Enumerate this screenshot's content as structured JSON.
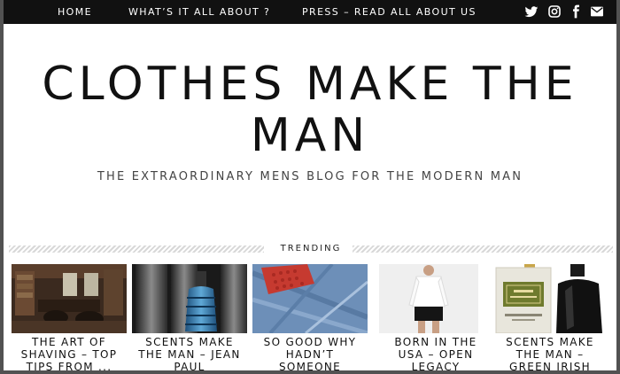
{
  "nav": {
    "items": [
      "HOME",
      "WHAT’S IT ALL ABOUT ?",
      "PRESS – READ ALL ABOUT US"
    ],
    "social_icons": [
      "twitter-icon",
      "instagram-icon",
      "facebook-icon",
      "email-icon"
    ]
  },
  "header": {
    "title_line1": "CLOTHES MAKE THE",
    "title_line2": "MAN",
    "tagline": "THE EXTRAORDINARY MENS BLOG FOR THE MODERN MAN"
  },
  "trending": {
    "label": "TRENDING",
    "cards": [
      {
        "title": "THE ART OF SHAVING – TOP TIPS FROM ..."
      },
      {
        "title": "SCENTS MAKE THE MAN – JEAN PAUL"
      },
      {
        "title": "SO GOOD WHY HADN’T SOMEONE"
      },
      {
        "title": "BORN IN THE USA – OPEN LEGACY"
      },
      {
        "title": "SCENTS MAKE THE MAN – GREEN IRISH"
      }
    ]
  },
  "colors": {
    "nav_bg": "#111111",
    "page_bg": "#ffffff",
    "frame": "#525252",
    "text": "#111111"
  }
}
